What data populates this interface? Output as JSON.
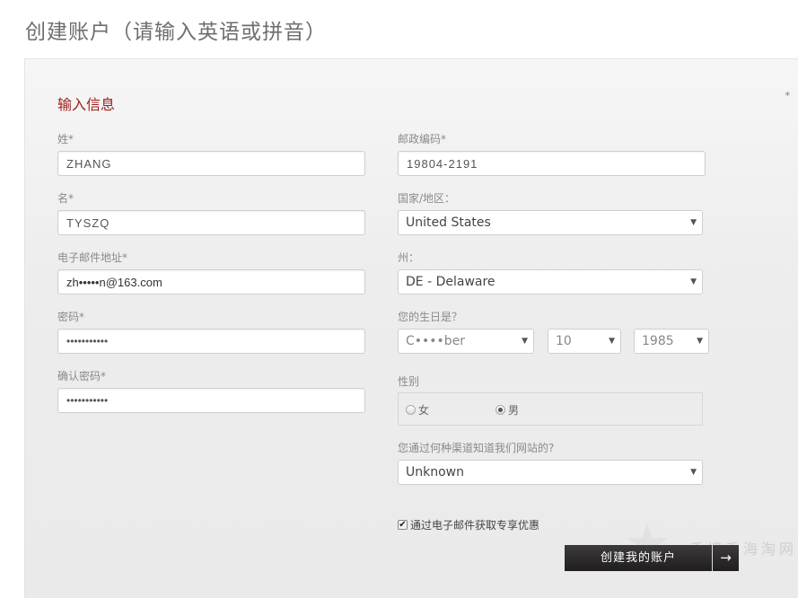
{
  "page": {
    "title": "创建账户（请输入英语或拼音）"
  },
  "form": {
    "section_title": "输入信息",
    "required_note": "*",
    "left": {
      "last_name": {
        "label": "姓*",
        "value": "ZHANG"
      },
      "first_name": {
        "label": "名*",
        "value": "TYSZQ"
      },
      "email": {
        "label": "电子邮件地址*",
        "value": "zh•••••n@163.com"
      },
      "password": {
        "label": "密码*",
        "value": "•••••••••••"
      },
      "confirm_password": {
        "label": "确认密码*",
        "value": "•••••••••••"
      }
    },
    "right": {
      "zip": {
        "label": "邮政编码*",
        "value": "19804-2191"
      },
      "country": {
        "label": "国家/地区：",
        "value": "United States"
      },
      "state": {
        "label": "州：",
        "value": "DE - Delaware"
      },
      "birthday": {
        "label": "您的生日是？",
        "month": "C••••ber",
        "day": "10",
        "year": "1985"
      },
      "gender": {
        "label": "性别",
        "options": [
          {
            "label": "女",
            "selected": false
          },
          {
            "label": "男",
            "selected": true
          }
        ]
      },
      "referral": {
        "label": "您通过何种渠道知道我们网站的?",
        "value": "Unknown"
      },
      "newsletter": {
        "label": "通过电子邮件获取专享优惠",
        "checked": true,
        "check_glyph": "✔"
      }
    },
    "submit": {
      "label": "创建我的账户",
      "arrow": "→"
    }
  },
  "icons": {
    "caret": "▼"
  },
  "watermark": {
    "text": "手把手海淘网",
    "star": "★"
  },
  "colors": {
    "section_title": "#a31c1c",
    "button_bg": "#2b2929"
  }
}
